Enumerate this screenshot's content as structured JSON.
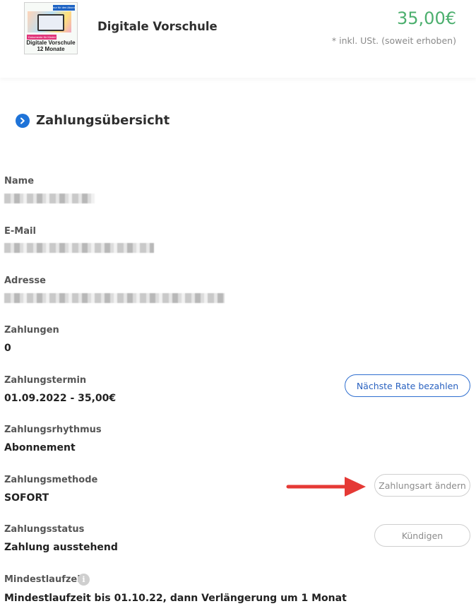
{
  "product": {
    "thumbnail": {
      "top_text": "nur für den Abonnement",
      "badge_text": "Dokumente für Kinder",
      "line1": "Digitale Vorschule",
      "line2": "12 Monate"
    },
    "name": "Digitale Vorschule",
    "price": "35,00€",
    "tax_note": "* inkl. USt. (soweit erhoben)"
  },
  "section": {
    "title": "Zahlungsübersicht",
    "icon": "chevron-right-circle-icon"
  },
  "fields": {
    "name_label": "Name",
    "email_label": "E-Mail",
    "address_label": "Adresse",
    "payments_label": "Zahlungen",
    "payments_value": "0",
    "due_label": "Zahlungstermin",
    "due_value": "01.09.2022 - 35,00€",
    "rhythm_label": "Zahlungsrhythmus",
    "rhythm_value": "Abonnement",
    "method_label": "Zahlungsmethode",
    "method_value": "SOFORT",
    "status_label": "Zahlungsstatus",
    "status_value": "Zahlung ausstehend",
    "min_term_label": "Mindestlaufzeit",
    "min_term_value": "Mindestlaufzeit bis 01.10.22, dann Verlängerung um 1 Monat"
  },
  "buttons": {
    "next_rate": "Nächste Rate bezahlen",
    "change_method": "Zahlungsart ändern",
    "cancel": "Kündigen"
  },
  "colors": {
    "price": "#4caf6e",
    "accent": "#1e73d8",
    "arrow": "#e53935"
  }
}
